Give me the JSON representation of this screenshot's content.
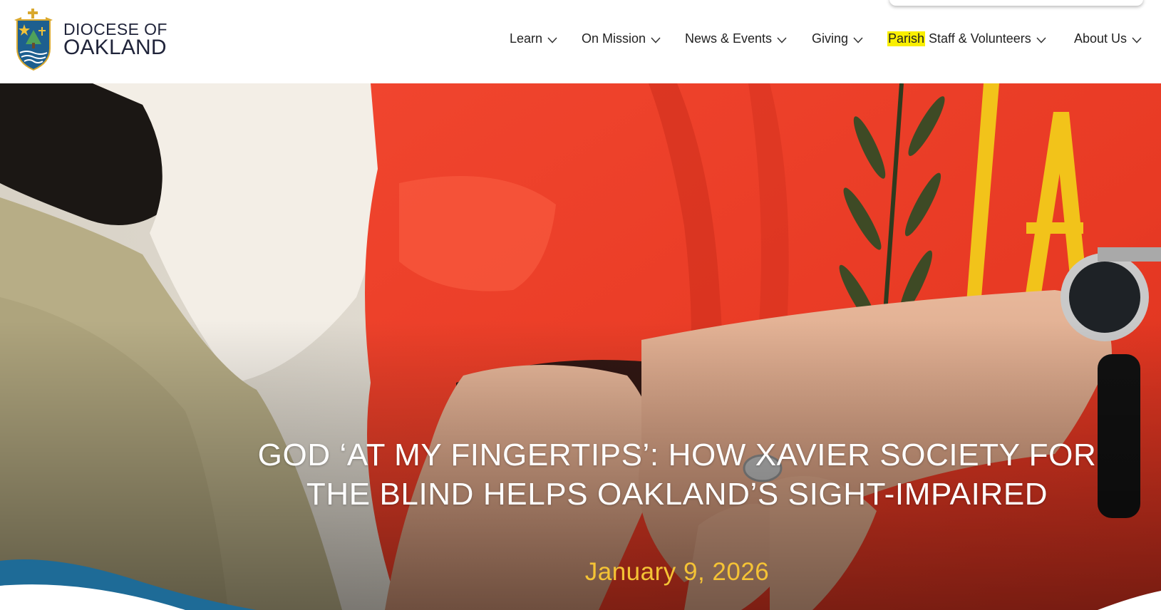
{
  "header": {
    "logo": {
      "line1": "DIOCESE OF",
      "line2": "OAKLAND"
    },
    "nav": [
      {
        "label": "Learn"
      },
      {
        "label": "On Mission"
      },
      {
        "label": "News & Events"
      },
      {
        "label": "Giving"
      },
      {
        "label_highlight": "Parish",
        "label": " Staff & Volunteers"
      },
      {
        "label": "About Us"
      }
    ]
  },
  "hero": {
    "title": "GOD ‘AT MY FINGERTIPS’: HOW XAVIER SOCIETY FOR THE BLIND HELPS OAKLAND’S SIGHT-IMPAIRED",
    "date": "January 9, 2026"
  },
  "colors": {
    "vestment_red": "#f2402b",
    "date_gold": "#f5c335",
    "search_highlight": "#f9ef00",
    "wave_blue": "#1e6b97",
    "brand_navy": "#20243a"
  },
  "icons": [
    "diocese-crest-icon",
    "chevron-down-icon"
  ]
}
